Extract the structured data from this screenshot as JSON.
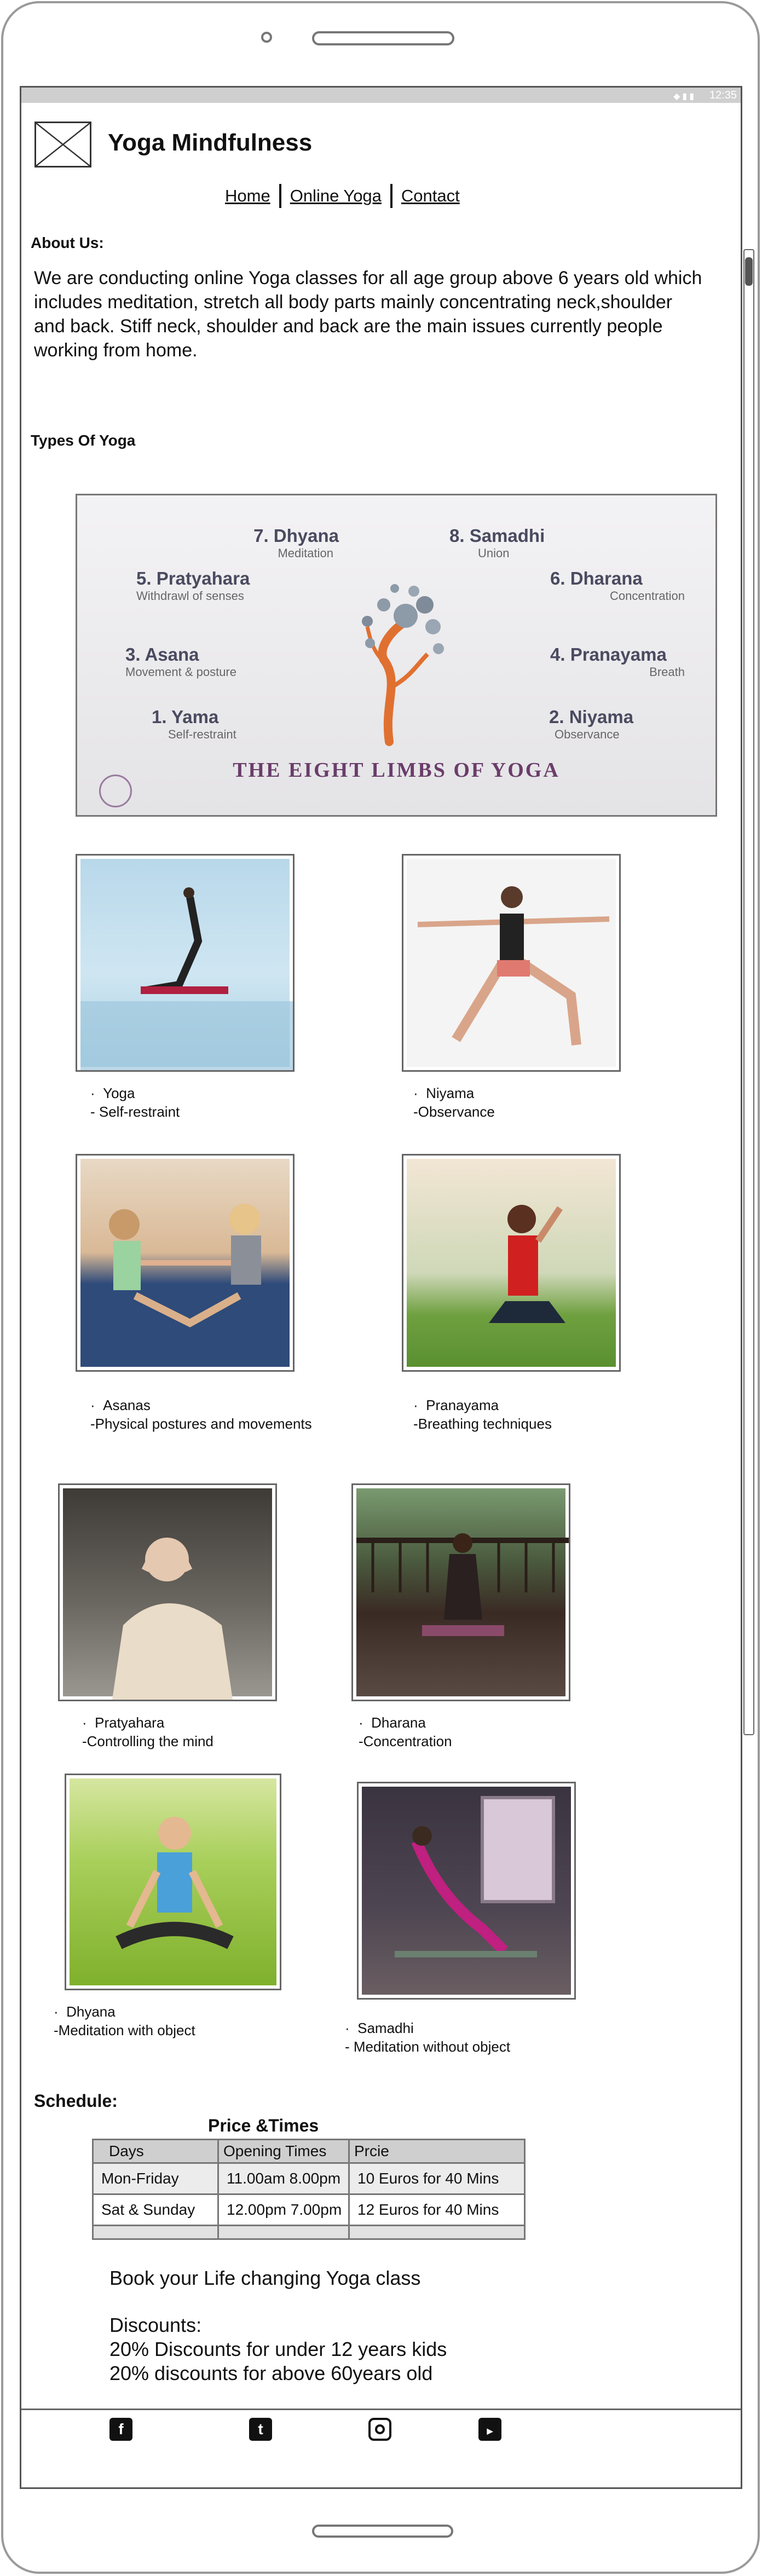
{
  "status": {
    "time": "12:35"
  },
  "header": {
    "title": "Yoga Mindfulness"
  },
  "nav": [
    {
      "label": "Home"
    },
    {
      "label": "Online Yoga"
    },
    {
      "label": "Contact"
    }
  ],
  "about": {
    "heading": "About Us:",
    "text": "We are conducting online Yoga classes for all age group above 6 years old which includes meditation, stretch all body parts mainly concentrating neck,shoulder and back. Stiff neck, shoulder and back are the main issues currently people working from home."
  },
  "types": {
    "heading": "Types Of Yoga"
  },
  "limbs_image": {
    "title": "THE EIGHT LIMBS OF YOGA",
    "limbs": [
      {
        "name": "7. Dhyana",
        "sub": "Meditation"
      },
      {
        "name": "8. Samadhi",
        "sub": "Union"
      },
      {
        "name": "5. Pratyahara",
        "sub": "Withdrawl of senses"
      },
      {
        "name": "6. Dharana",
        "sub": "Concentration"
      },
      {
        "name": "3. Asana",
        "sub": "Movement & posture"
      },
      {
        "name": "4. Pranayama",
        "sub": "Breath"
      },
      {
        "name": "1. Yama",
        "sub": "Self-restraint"
      },
      {
        "name": "2. Niyama",
        "sub": "Observance"
      }
    ]
  },
  "cards": [
    {
      "line1": "Yoga",
      "line2": "- Self-restraint"
    },
    {
      "line1": "Niyama",
      "line2": "-Observance"
    },
    {
      "line1": "Asanas",
      "line2": "-Physical postures and movements"
    },
    {
      "line1": "Pranayama",
      "line2": "-Breathing techniques"
    },
    {
      "line1": "Pratyahara",
      "line2": "-Controlling the mind"
    },
    {
      "line1": "Dharana",
      "line2": "-Concentration"
    },
    {
      "line1": "Dhyana",
      "line2": "-Meditation with object"
    },
    {
      "line1": "Samadhi",
      "line2": "- Meditation without object"
    }
  ],
  "schedule": {
    "heading": "Schedule:",
    "table_title": "Price &Times",
    "columns": [
      "Days",
      "Opening Times",
      "Prcie"
    ],
    "rows": [
      [
        "Mon-Friday",
        "11.00am 8.00pm",
        "10 Euros for 40 Mins"
      ],
      [
        "Sat & Sunday",
        "12.00pm 7.00pm",
        "12 Euros for 40 Mins"
      ]
    ]
  },
  "promo": {
    "book": "Book your Life changing Yoga class",
    "discount_heading": "Discounts:",
    "discounts": [
      "20% Discounts for under 12 years kids",
      "20% discounts for above 60years old"
    ]
  },
  "footer": {
    "icons": [
      "facebook-icon",
      "twitter-icon",
      "instagram-icon",
      "youtube-icon"
    ]
  },
  "colors": {
    "frame": "#9a9a9a",
    "statusbar": "#cfcfcf",
    "table_header": "#cfcfcf",
    "limb_accent": "#6a3d6a"
  }
}
